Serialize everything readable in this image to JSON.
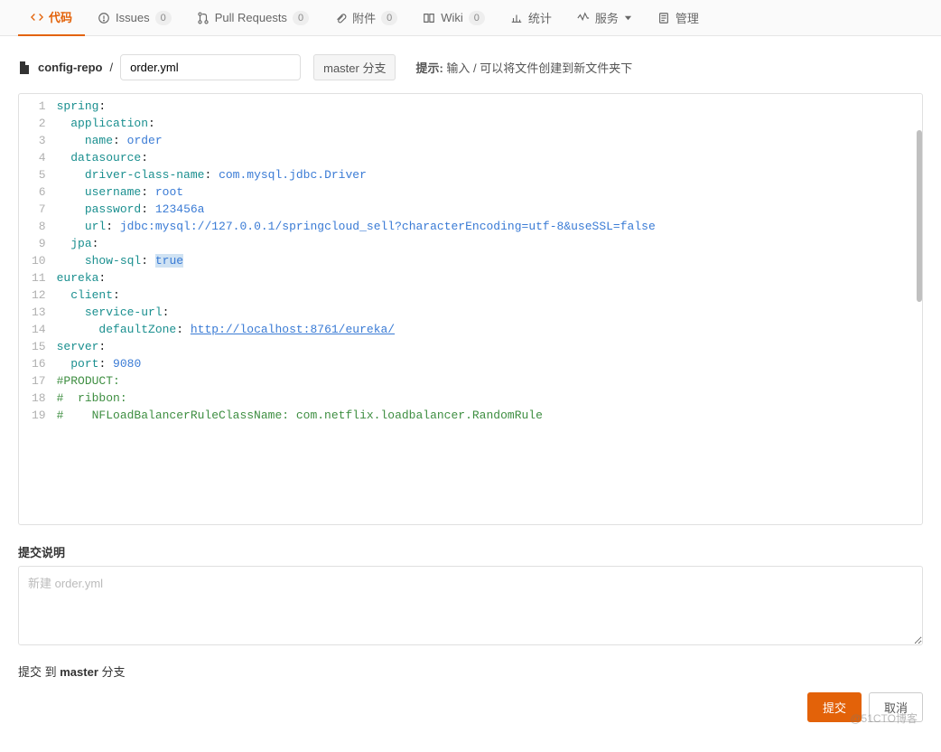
{
  "tabs": {
    "code": "代码",
    "issues": "Issues",
    "issues_badge": "0",
    "pulls": "Pull Requests",
    "pulls_badge": "0",
    "attachments": "附件",
    "attachments_badge": "0",
    "wiki": "Wiki",
    "wiki_badge": "0",
    "stats": "统计",
    "services": "服务",
    "manage": "管理"
  },
  "file": {
    "repo": "config-repo",
    "sep": " / ",
    "name": "order.yml",
    "branch": "master 分支",
    "hint_label": "提示:",
    "hint_text": " 输入 / 可以将文件创建到新文件夹下"
  },
  "code_lines": [
    {
      "n": 1,
      "segs": [
        {
          "t": "spring",
          "c": "k"
        },
        {
          "t": ":",
          "c": "p"
        }
      ]
    },
    {
      "n": 2,
      "segs": [
        {
          "t": "  ",
          "c": ""
        },
        {
          "t": "application",
          "c": "k"
        },
        {
          "t": ":",
          "c": "p"
        }
      ]
    },
    {
      "n": 3,
      "segs": [
        {
          "t": "    ",
          "c": ""
        },
        {
          "t": "name",
          "c": "k"
        },
        {
          "t": ": ",
          "c": "p"
        },
        {
          "t": "order",
          "c": "v"
        }
      ]
    },
    {
      "n": 4,
      "segs": [
        {
          "t": "  ",
          "c": ""
        },
        {
          "t": "datasource",
          "c": "k"
        },
        {
          "t": ":",
          "c": "p"
        }
      ]
    },
    {
      "n": 5,
      "segs": [
        {
          "t": "    ",
          "c": ""
        },
        {
          "t": "driver-class-name",
          "c": "k"
        },
        {
          "t": ": ",
          "c": "p"
        },
        {
          "t": "com.mysql.jdbc.Driver",
          "c": "v"
        }
      ]
    },
    {
      "n": 6,
      "segs": [
        {
          "t": "    ",
          "c": ""
        },
        {
          "t": "username",
          "c": "k"
        },
        {
          "t": ": ",
          "c": "p"
        },
        {
          "t": "root",
          "c": "v"
        }
      ]
    },
    {
      "n": 7,
      "segs": [
        {
          "t": "    ",
          "c": ""
        },
        {
          "t": "password",
          "c": "k"
        },
        {
          "t": ": ",
          "c": "p"
        },
        {
          "t": "123456a",
          "c": "v"
        }
      ]
    },
    {
      "n": 8,
      "segs": [
        {
          "t": "    ",
          "c": ""
        },
        {
          "t": "url",
          "c": "k"
        },
        {
          "t": ": ",
          "c": "p"
        },
        {
          "t": "jdbc:mysql://127.0.0.1/springcloud_sell?characterEncoding=utf-8&useSSL=false",
          "c": "v"
        }
      ]
    },
    {
      "n": 9,
      "segs": [
        {
          "t": "  ",
          "c": ""
        },
        {
          "t": "jpa",
          "c": "k"
        },
        {
          "t": ":",
          "c": "p"
        }
      ]
    },
    {
      "n": 10,
      "segs": [
        {
          "t": "    ",
          "c": ""
        },
        {
          "t": "show-sql",
          "c": "k"
        },
        {
          "t": ": ",
          "c": "p"
        },
        {
          "t": "true",
          "c": "v hl"
        }
      ]
    },
    {
      "n": 11,
      "segs": [
        {
          "t": "eureka",
          "c": "k"
        },
        {
          "t": ":",
          "c": "p"
        }
      ]
    },
    {
      "n": 12,
      "segs": [
        {
          "t": "  ",
          "c": ""
        },
        {
          "t": "client",
          "c": "k"
        },
        {
          "t": ":",
          "c": "p"
        }
      ]
    },
    {
      "n": 13,
      "segs": [
        {
          "t": "    ",
          "c": ""
        },
        {
          "t": "service-url",
          "c": "k"
        },
        {
          "t": ":",
          "c": "p"
        }
      ]
    },
    {
      "n": 14,
      "segs": [
        {
          "t": "      ",
          "c": ""
        },
        {
          "t": "defaultZone",
          "c": "k"
        },
        {
          "t": ": ",
          "c": "p"
        },
        {
          "t": "http://localhost:8761/eureka/",
          "c": "url"
        }
      ]
    },
    {
      "n": 15,
      "segs": [
        {
          "t": "server",
          "c": "k"
        },
        {
          "t": ":",
          "c": "p"
        }
      ]
    },
    {
      "n": 16,
      "segs": [
        {
          "t": "  ",
          "c": ""
        },
        {
          "t": "port",
          "c": "k"
        },
        {
          "t": ": ",
          "c": "p"
        },
        {
          "t": "9080",
          "c": "v"
        }
      ]
    },
    {
      "n": 17,
      "segs": [
        {
          "t": "#PRODUCT:",
          "c": "comment"
        }
      ]
    },
    {
      "n": 18,
      "segs": [
        {
          "t": "#  ribbon:",
          "c": "comment"
        }
      ]
    },
    {
      "n": 19,
      "segs": [
        {
          "t": "#    NFLoadBalancerRuleClassName: com.netflix.loadbalancer.RandomRule",
          "c": "comment"
        }
      ]
    }
  ],
  "commit": {
    "section_label": "提交说明",
    "placeholder": "新建 order.yml",
    "to_prefix": "提交 到 ",
    "to_branch": "master",
    "to_suffix": " 分支",
    "submit": "提交",
    "cancel": "取消"
  },
  "watermark": "@51CTO博客"
}
